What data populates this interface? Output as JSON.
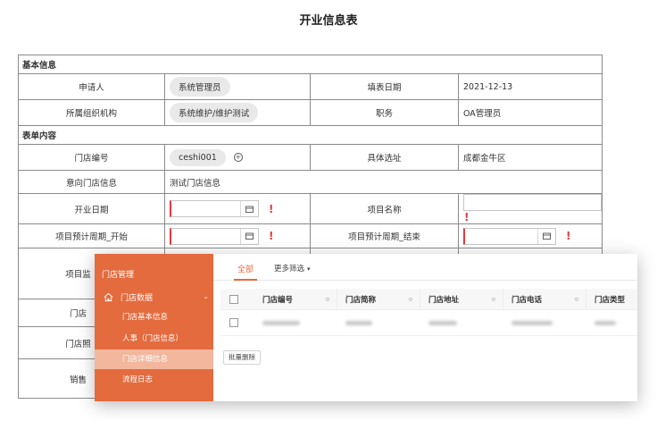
{
  "title": "开业信息表",
  "form": {
    "basic_header": "基本信息",
    "applicant_label": "申请人",
    "applicant_value": "系统管理员",
    "fill_date_label": "填表日期",
    "fill_date_value": "2021-12-13",
    "org_label": "所属组织机构",
    "org_value": "系统维护/维护测试",
    "position_label": "职务",
    "position_value": "OA管理员",
    "content_header": "表单内容",
    "store_no_label": "门店编号",
    "store_no_value": "ceshi001",
    "address_label": "具体选址",
    "address_value": "成都金牛区",
    "intent_label": "意向门店信息",
    "intent_value": "测试门店信息",
    "open_date_label": "开业日期",
    "project_name_label": "项目名称",
    "period_start_label": "项目预计周期_开始",
    "period_end_label": "项目预计周期_结束",
    "partial_label_1": "项目监",
    "partial_label_2": "门店",
    "partial_label_3": "门店照",
    "partial_label_4": "销售",
    "required_mark": "!"
  },
  "overlay": {
    "sidebar": {
      "title": "门店管理",
      "group_label": "门店数据",
      "items": [
        {
          "label": "门店基本信息",
          "active": false
        },
        {
          "label": "人事（门店信息）",
          "active": false
        },
        {
          "label": "门店详细信息",
          "active": true
        },
        {
          "label": "流程日志",
          "active": false
        }
      ]
    },
    "tabs": {
      "all": "全部",
      "more": "更多筛选"
    },
    "columns": [
      "门店编号",
      "门店简称",
      "门店地址",
      "门店电话",
      "门店类型"
    ],
    "batch_delete": "批量删除"
  },
  "colors": {
    "accent": "#e36b3e",
    "required": "#e4393c",
    "active_item": "#f2b79d"
  }
}
